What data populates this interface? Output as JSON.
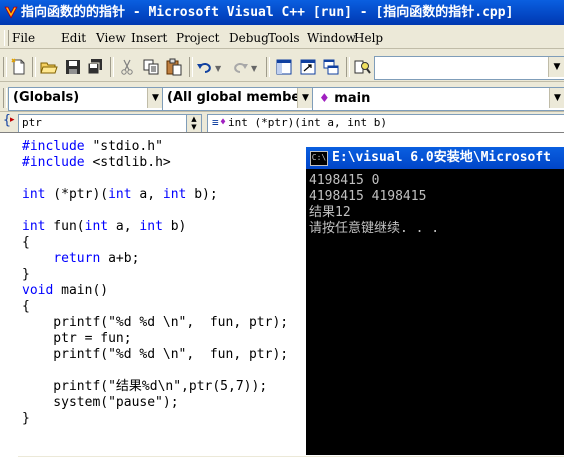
{
  "window": {
    "title": "指向函数的的指针 - Microsoft Visual C++ [run] - [指向函数的指针.cpp]"
  },
  "menubar": {
    "items": [
      "File",
      "Edit",
      "View",
      "Insert",
      "Project",
      "Debug",
      "Tools",
      "Window",
      "Help"
    ]
  },
  "toolbar": {
    "icons": [
      "new-document",
      "open-folder",
      "save",
      "save-all",
      "cut",
      "copy",
      "paste",
      "undo",
      "redo",
      "workspace",
      "output",
      "window-list",
      "find-in-files"
    ],
    "find_value": ""
  },
  "wizardbar": {
    "class_combo": "(Globals)",
    "members_combo": "(All global members",
    "function_combo": "main"
  },
  "symbolbar": {
    "left_value": "ptr",
    "right_value": "int (*ptr)(int a, int b)"
  },
  "editor": {
    "lines": [
      "#include \"stdio.h\"",
      "#include <stdlib.h>",
      "",
      "int (*ptr)(int a, int b);",
      "",
      "int fun(int a, int b)",
      "{",
      "    return a+b;",
      "}",
      "void main()",
      "{",
      "    printf(\"%d %d \\n\",  fun, ptr);",
      "    ptr = fun;",
      "    printf(\"%d %d \\n\",  fun, ptr);",
      "",
      "    printf(\"结果%d\\n\",ptr(5,7));",
      "    system(\"pause\");",
      "}"
    ]
  },
  "console": {
    "title": "E:\\visual 6.0安装地\\Microsoft",
    "icon_text": "C:\\",
    "lines": [
      "4198415 0",
      "4198415 4198415",
      "结果12",
      "请按任意键继续. . ."
    ]
  },
  "colors": {
    "titlebar": "#0347c4",
    "keyword": "#0000ff",
    "console_bg": "#000000",
    "console_fg": "#c0c0c0",
    "chrome": "#ece9d8"
  }
}
